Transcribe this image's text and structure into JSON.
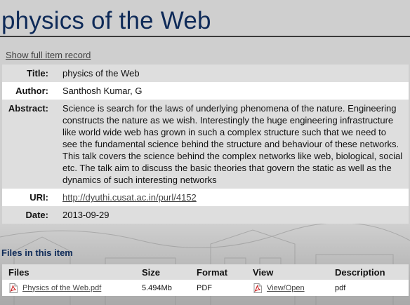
{
  "page": {
    "title": "physics of the Web",
    "full_record_link": "Show full item record"
  },
  "metadata": [
    {
      "label": "Title:",
      "value": "physics of the Web"
    },
    {
      "label": "Author:",
      "value": "Santhosh Kumar, G"
    },
    {
      "label": "Abstract:",
      "value": "Science is search for the laws of underlying phenomena of the nature. Engineering constructs the nature as we wish. Interestingly the huge engineering infrastructure like world  wide web has grown in such a complex structure such that we need to see the fundamental  science behind the structure and behaviour of these networks. This talk covers the science  behind the complex networks like web, biological, social etc. The talk aim to discuss the  basic theories that govern the static as well as the dynamics of such interesting networks"
    },
    {
      "label": "URI:",
      "value": "http://dyuthi.cusat.ac.in/purl/4152"
    },
    {
      "label": "Date:",
      "value": "2013-09-29"
    }
  ],
  "files": {
    "heading": "Files in this item",
    "columns": {
      "files": "Files",
      "size": "Size",
      "format": "Format",
      "view": "View",
      "description": "Description"
    },
    "rows": [
      {
        "name": "Physics of the Web.pdf",
        "size": "5.494Mb",
        "format": "PDF",
        "view": "View/Open",
        "description": "pdf"
      }
    ]
  },
  "colors": {
    "title": "#0e2a58",
    "row_grey": "#dedede",
    "row_white": "#ffffff",
    "link": "#444444",
    "pdf_icon": "#cc2222"
  },
  "icons": {
    "file_icon": "pdf-file-icon",
    "view_icon": "pdf-file-icon"
  }
}
